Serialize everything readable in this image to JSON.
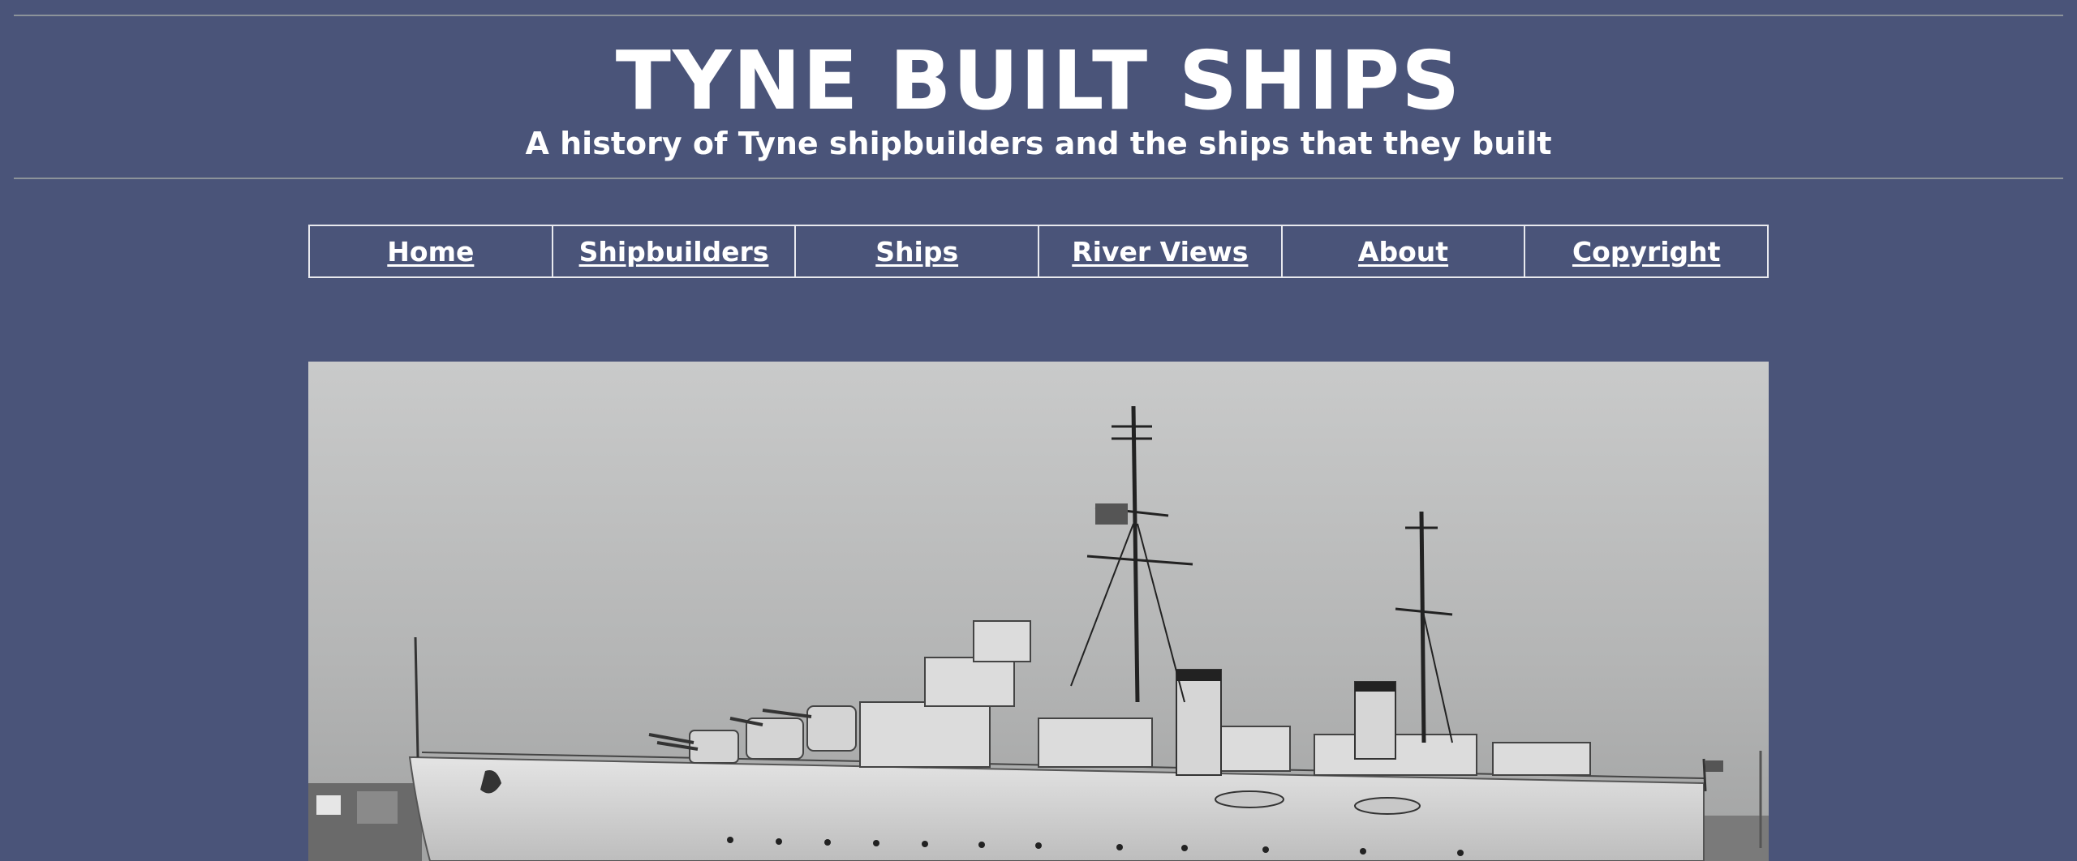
{
  "header": {
    "title": "TYNE BUILT SHIPS",
    "subtitle": "A history of Tyne shipbuilders and the ships that they built"
  },
  "nav": {
    "items": [
      {
        "label": "Home"
      },
      {
        "label": "Shipbuilders"
      },
      {
        "label": "Ships"
      },
      {
        "label": "River Views"
      },
      {
        "label": "About"
      },
      {
        "label": "Copyright"
      }
    ]
  },
  "colors": {
    "background": "#4a5479",
    "text": "#ffffff",
    "rule": "#8c939a"
  }
}
